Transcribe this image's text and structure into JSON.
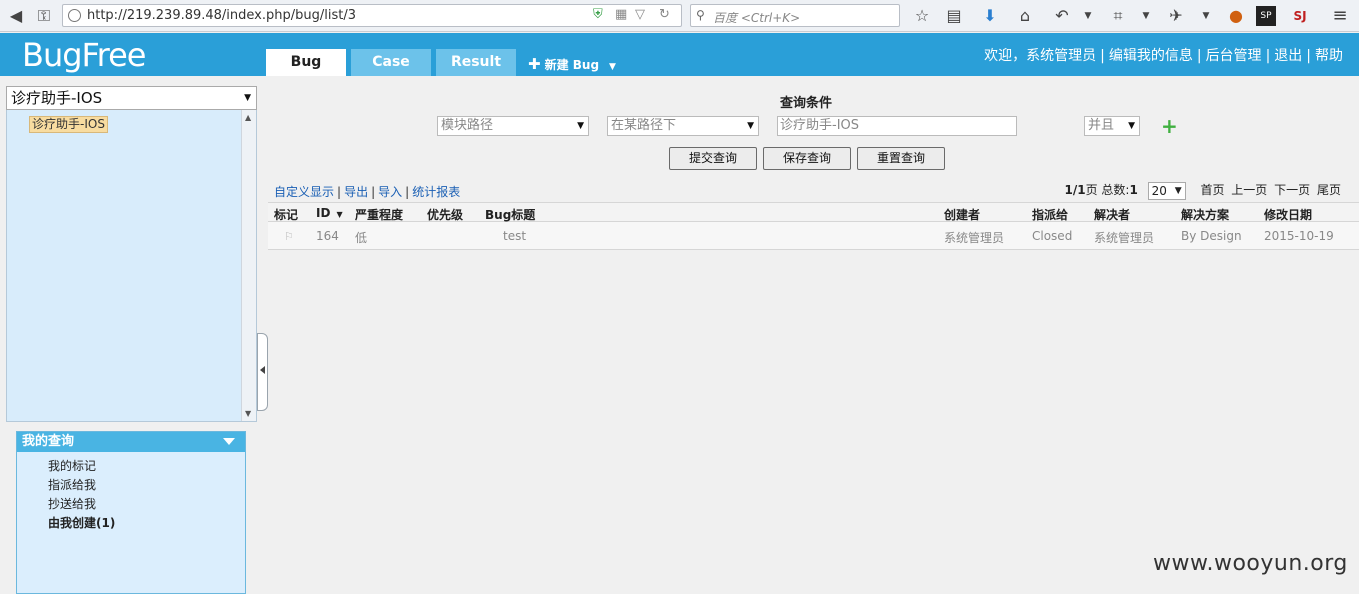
{
  "browser": {
    "url": "http://219.239.89.48/index.php/bug/list/3",
    "search_placeholder": "百度 <Ctrl+K>"
  },
  "header": {
    "logo": "BugFree",
    "tabs": [
      {
        "label": "Bug",
        "active": true
      },
      {
        "label": "Case",
        "active": false
      },
      {
        "label": "Result",
        "active": false
      }
    ],
    "new_bug": "新建 Bug",
    "user_links": [
      "欢迎，系统管理员",
      "编辑我的信息",
      "后台管理",
      "退出",
      "帮助"
    ]
  },
  "sidebar": {
    "product": "诊疗助手-IOS",
    "tree_node": "诊疗助手-IOS",
    "queries_title": "我的查询",
    "queries": [
      "我的标记",
      "指派给我",
      "抄送给我",
      "由我创建(1)"
    ]
  },
  "query": {
    "title": "查询条件",
    "field": "模块路径",
    "operator": "在某路径下",
    "value": "诊疗助手-IOS",
    "logic": "并且",
    "buttons": [
      "提交查询",
      "保存查询",
      "重置查询"
    ]
  },
  "toolbar": {
    "links": [
      "自定义显示",
      "导出",
      "导入",
      "统计报表"
    ]
  },
  "pager": {
    "page": "1/1",
    "page_suffix": "页 总数:",
    "total": "1",
    "page_size": "20",
    "nav": [
      "首页",
      "上一页",
      "下一页",
      "尾页"
    ]
  },
  "table": {
    "columns": [
      "标记",
      "ID",
      "严重程度",
      "优先级",
      "Bug标题",
      "创建者",
      "指派给",
      "解决者",
      "解决方案",
      "修改日期"
    ],
    "rows": [
      {
        "id": "164",
        "severity": "低",
        "priority": "",
        "title": "test",
        "creator": "系统管理员",
        "assignee": "Closed",
        "resolver": "系统管理员",
        "resolution": "By Design",
        "date": "2015-10-19"
      }
    ]
  },
  "watermark": "www.wooyun.org"
}
